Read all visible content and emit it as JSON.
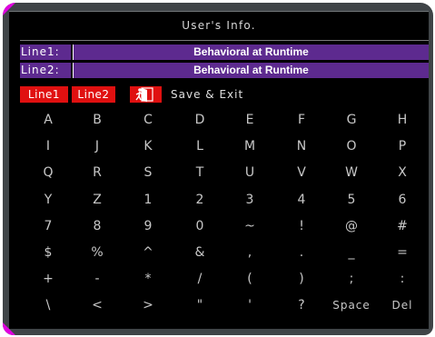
{
  "title": "User's  Info.",
  "lines": [
    {
      "label": "Line1:",
      "value": "Behavioral at Runtime"
    },
    {
      "label": "Line2:",
      "value": "Behavioral at Runtime"
    }
  ],
  "controls": {
    "line1": "Line1",
    "line2": "Line2",
    "exit_icon": "exit-door-icon",
    "save_exit": "Save & Exit"
  },
  "keyboard": {
    "rows": [
      [
        "A",
        "B",
        "C",
        "D",
        "E",
        "F",
        "G",
        "H"
      ],
      [
        "I",
        "J",
        "K",
        "L",
        "M",
        "N",
        "O",
        "P"
      ],
      [
        "Q",
        "R",
        "S",
        "T",
        "U",
        "V",
        "W",
        "X"
      ],
      [
        "Y",
        "Z",
        "1",
        "2",
        "3",
        "4",
        "5",
        "6"
      ],
      [
        "7",
        "8",
        "9",
        "0",
        "~",
        "!",
        "@",
        "#"
      ],
      [
        "$",
        "%",
        "^",
        "&",
        ",",
        ".",
        "_",
        "="
      ],
      [
        "+",
        "-",
        "*",
        "/",
        "(",
        ")",
        ";",
        ":"
      ],
      [
        "\\",
        "<",
        ">",
        "\"",
        "'",
        "?",
        "Space",
        "Del"
      ]
    ]
  },
  "colors": {
    "frame": "#3f4447",
    "screen": "#000000",
    "field": "#5d2a8f",
    "button": "#e01010",
    "accent_corner": "#e000e0"
  }
}
